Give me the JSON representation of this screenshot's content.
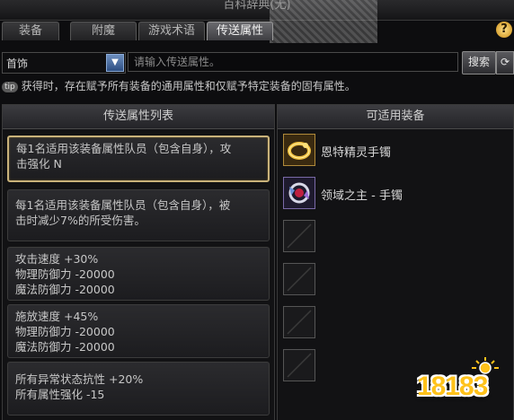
{
  "window": {
    "title": "百科辞典(无)"
  },
  "tabs": [
    {
      "label": "装备"
    },
    {
      "label": "附魔"
    },
    {
      "label": "游戏术语"
    },
    {
      "label": "传送属性"
    }
  ],
  "help_icon": "question-icon",
  "search": {
    "category_value": "首饰",
    "placeholder": "请输入传送属性。",
    "search_label": "搜索"
  },
  "tip": {
    "badge": "tip",
    "text": "获得时，存在赋予所有装备的通用属性和仅赋予特定装备的固有属性。"
  },
  "left_panel": {
    "header": "传送属性列表",
    "items": [
      {
        "lines": [
          "每1名适用该装备属性队员（包含自身），攻",
          "击强化 N"
        ]
      },
      {
        "lines": [
          "每1名适用该装备属性队员（包含自身），被",
          "击时减少7%的所受伤害。"
        ]
      },
      {
        "lines": [
          "攻击速度 +30%",
          "物理防御力 -20000",
          "魔法防御力 -20000"
        ]
      },
      {
        "lines": [
          "施放速度 +45%",
          "物理防御力 -20000",
          "魔法防御力 -20000"
        ]
      },
      {
        "lines": [
          "所有异常状态抗性 +20%",
          "所有属性强化 -15"
        ]
      }
    ]
  },
  "right_panel": {
    "header": "可适用装备",
    "items": [
      {
        "name": "恩特精灵手镯",
        "icon": "gold-bracelet-icon"
      },
      {
        "name": "领域之主 - 手镯",
        "icon": "domain-bracelet-icon"
      },
      {
        "name": "",
        "icon": "empty-slot-icon"
      },
      {
        "name": "",
        "icon": "empty-slot-icon"
      },
      {
        "name": "",
        "icon": "empty-slot-icon"
      },
      {
        "name": "",
        "icon": "empty-slot-icon"
      }
    ]
  },
  "watermark": {
    "text": "18183"
  },
  "colors": {
    "accent_gold": "#c9b27a",
    "logo_yellow": "#ffc21a",
    "dropdown_blue": "#3d6199"
  }
}
